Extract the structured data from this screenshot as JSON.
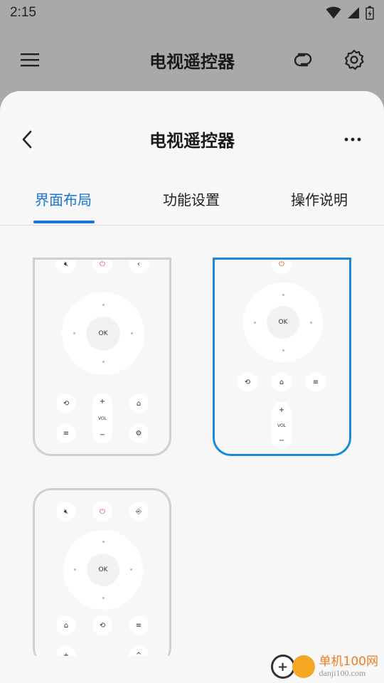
{
  "status_bar": {
    "time": "2:15",
    "icons": [
      "wifi-icon",
      "cellular-icon",
      "battery-icon"
    ]
  },
  "app_bar": {
    "title": "电视遥控器",
    "icons": [
      "menu-icon",
      "link-icon",
      "settings-icon"
    ]
  },
  "sheet": {
    "title": "电视遥控器",
    "icons": [
      "back-icon",
      "more-icon"
    ],
    "tabs": [
      {
        "label": "界面布局",
        "active": true
      },
      {
        "label": "功能设置",
        "active": false
      },
      {
        "label": "操作说明",
        "active": false
      }
    ]
  },
  "layouts": [
    {
      "name": "layout-1",
      "selected": false,
      "ok_label": "OK",
      "vol_label": "VOL",
      "buttons": {
        "top": [
          "mute-icon",
          "power-icon",
          "back-arrow-icon"
        ],
        "bottom": [
          "return-icon",
          "home-icon",
          "menu-icon",
          "settings-icon"
        ],
        "vol_plus": "+",
        "vol_minus": "−"
      }
    },
    {
      "name": "layout-2",
      "selected": true,
      "ok_label": "OK",
      "vol_label": "VOL",
      "buttons": {
        "top": [
          "power-icon"
        ],
        "middle": [
          "return-icon",
          "home-icon",
          "menu-icon"
        ],
        "vol_plus": "+",
        "vol_minus": "−"
      }
    },
    {
      "name": "layout-3",
      "selected": false,
      "ok_label": "OK",
      "buttons": {
        "top": [
          "mute-icon",
          "power-icon",
          "input-icon"
        ],
        "middle": [
          "home-icon",
          "return-icon",
          "menu-icon"
        ],
        "bottom_partial": [
          "+",
          "^"
        ]
      }
    }
  ],
  "watermark": {
    "cn": "单机100网",
    "url": "danji100.com"
  },
  "colors": {
    "accent": "#1976d2",
    "selected_border": "#1a8ad8",
    "power": "#e04a2f",
    "card_border": "#d0d0d0"
  }
}
